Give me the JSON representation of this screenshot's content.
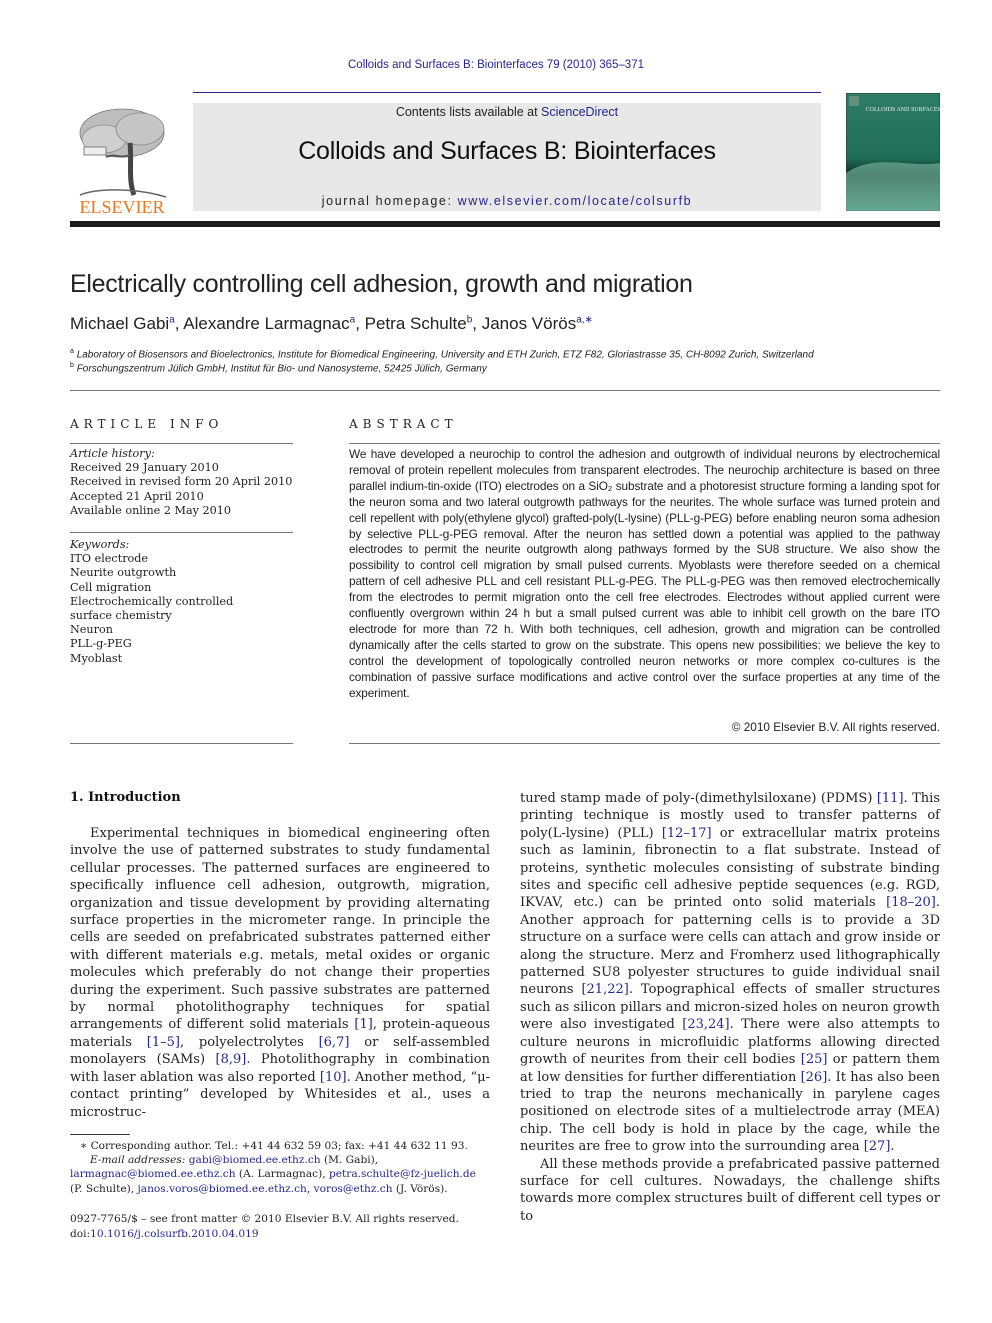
{
  "header": {
    "running_head": "Colloids and Surfaces B: Biointerfaces 79 (2010) 365–371",
    "contents_prefix": "Contents lists available at ",
    "contents_link": "ScienceDirect",
    "journal_title": "Colloids and Surfaces B: Biointerfaces",
    "homepage_prefix": "journal homepage: ",
    "homepage_link": "www.elsevier.com/locate/colsurfb",
    "publisher_logo_text": "ELSEVIER",
    "cover_title": "COLLOIDS AND SURFACES B",
    "colors": {
      "link": "#26268a",
      "elsevier_orange": "#e87722",
      "banner_bg": "#e8e8e8",
      "cover_green": "#1f6e55"
    }
  },
  "article": {
    "title": "Electrically controlling cell adhesion, growth and migration",
    "authors": [
      {
        "name": "Michael Gabi",
        "sup": "a"
      },
      {
        "name": "Alexandre Larmagnac",
        "sup": "a"
      },
      {
        "name": "Petra Schulte",
        "sup": "b"
      },
      {
        "name": "Janos Vörös",
        "sup": "a,∗"
      }
    ],
    "affiliations": [
      {
        "sup": "a",
        "text": "Laboratory of Biosensors and Bioelectronics, Institute for Biomedical Engineering, University and ETH Zurich, ETZ F82, Gloriastrasse 35, CH-8092 Zurich, Switzerland"
      },
      {
        "sup": "b",
        "text": "Forschungszentrum Jülich GmbH, Institut für Bio- und Nanosysteme, 52425 Jülich, Germany"
      }
    ]
  },
  "article_info": {
    "heading": "ARTICLE INFO",
    "history_label": "Article history:",
    "history": [
      "Received 29 January 2010",
      "Received in revised form 20 April 2010",
      "Accepted 21 April 2010",
      "Available online 2 May 2010"
    ],
    "keywords_label": "Keywords:",
    "keywords": [
      "ITO electrode",
      "Neurite outgrowth",
      "Cell migration",
      "Electrochemically controlled surface chemistry",
      "Neuron",
      "PLL-g-PEG",
      "Myoblast"
    ]
  },
  "abstract": {
    "heading": "ABSTRACT",
    "text": "We have developed a neurochip to control the adhesion and outgrowth of individual neurons by electrochemical removal of protein repellent molecules from transparent electrodes. The neurochip architecture is based on three parallel indium-tin-oxide (ITO) electrodes on a SiO₂ substrate and a photoresist structure forming a landing spot for the neuron soma and two lateral outgrowth pathways for the neurites. The whole surface was turned protein and cell repellent with poly(ethylene glycol) grafted-poly(L-lysine) (PLL-g-PEG) before enabling neuron soma adhesion by selective PLL-g-PEG removal. After the neuron has settled down a potential was applied to the pathway electrodes to permit the neurite outgrowth along pathways formed by the SU8 structure. We also show the possibility to control cell migration by small pulsed currents. Myoblasts were therefore seeded on a chemical pattern of cell adhesive PLL and cell resistant PLL-g-PEG. The PLL-g-PEG was then removed electrochemically from the electrodes to permit migration onto the cell free electrodes. Electrodes without applied current were confluently overgrown within 24 h but a small pulsed current was able to inhibit cell growth on the bare ITO electrode for more than 72 h. With both techniques, cell adhesion, growth and migration can be controlled dynamically after the cells started to grow on the substrate. This opens new possibilities: we believe the key to control the development of topologically controlled neuron networks or more complex co-cultures is the combination of passive surface modifications and active control over the surface properties at any time of the experiment.",
    "copyright": "© 2010 Elsevier B.V. All rights reserved."
  },
  "introduction": {
    "heading": "1.  Introduction",
    "left_col": [
      {
        "t": "Experimental techniques in biomedical engineering often involve the use of patterned substrates to study fundamental cellular processes. The patterned surfaces are engineered to specifically influence cell adhesion, outgrowth, migration, organization and tissue development by providing alternating surface properties in the micrometer range. In principle the cells are seeded on prefabricated substrates patterned either with different materials e.g. metals, metal oxides or organic molecules which preferably do not change their properties during the experiment. Such passive substrates are patterned by normal photolithography techniques for spatial arrangements of different solid materials "
      },
      {
        "ref": "[1]"
      },
      {
        "t": ", protein-aqueous materials "
      },
      {
        "ref": "[1–5]"
      },
      {
        "t": ", polyelectrolytes "
      },
      {
        "ref": "[6,7]"
      },
      {
        "t": " or self-assembled monolayers (SAMs) "
      },
      {
        "ref": "[8,9]"
      },
      {
        "t": ". Photolithography in combination with laser ablation was also reported "
      },
      {
        "ref": "[10]"
      },
      {
        "t": ". Another method, “μ-contact printing” developed by Whitesides et al., uses a microstruc-"
      }
    ],
    "right_col_p1": [
      {
        "t": "tured stamp made of poly-(dimethylsiloxane) (PDMS) "
      },
      {
        "ref": "[11]"
      },
      {
        "t": ". This printing technique is mostly used to transfer patterns of poly(L-lysine) (PLL) "
      },
      {
        "ref": "[12–17]"
      },
      {
        "t": " or extracellular matrix proteins such as laminin, fibronectin to a flat substrate. Instead of proteins, synthetic molecules consisting of substrate binding sites and specific cell adhesive peptide sequences (e.g. RGD, IKVAV, etc.) can be printed onto solid materials "
      },
      {
        "ref": "[18–20]"
      },
      {
        "t": ". Another approach for patterning cells is to provide a 3D structure on a surface were cells can attach and grow inside or along the structure. Merz and Fromherz used lithographically patterned SU8 polyester structures to guide individual snail neurons "
      },
      {
        "ref": "[21,22]"
      },
      {
        "t": ". Topographical effects of smaller structures such as silicon pillars and micron-sized holes on neuron growth were also investigated "
      },
      {
        "ref": "[23,24]"
      },
      {
        "t": ". There were also attempts to culture neurons in microfluidic platforms allowing directed growth of neurites from their cell bodies "
      },
      {
        "ref": "[25]"
      },
      {
        "t": " or pattern them at low densities for further differentiation "
      },
      {
        "ref": "[26]"
      },
      {
        "t": ". It has also been tried to trap the neurons mechanically in parylene cages positioned on electrode sites of a multielectrode array (MEA) chip. The cell body is hold in place by the cage, while the neurites are free to grow into the surrounding area "
      },
      {
        "ref": "[27]"
      },
      {
        "t": "."
      }
    ],
    "right_col_p2": "All these methods provide a prefabricated passive patterned surface for cell cultures. Nowadays, the challenge shifts towards more complex structures built of different cell types or to"
  },
  "footnotes": {
    "corresponding": "∗ Corresponding author. Tel.: +41 44 632 59 03; fax: +41 44 632 11 93.",
    "email_label": "E-mail addresses:",
    "emails": [
      {
        "addr": "gabi@biomed.ee.ethz.ch",
        "who": " (M. Gabi),",
        "br": true
      },
      {
        "addr": "larmagnac@biomed.ee.ethz.ch",
        "who": " (A. Larmagnac), "
      },
      {
        "addr": "petra.schulte@fz-juelich.de",
        "who": "",
        "br": true
      },
      {
        "addr": "",
        "who": "(P. Schulte), "
      },
      {
        "addr": "janos.voros@biomed.ee.ethz.ch",
        "who": ", "
      },
      {
        "addr": "voros@ethz.ch",
        "who": " (J. Vörös)."
      }
    ],
    "front_matter": "0927-7765/$ – see front matter © 2010 Elsevier B.V. All rights reserved.",
    "doi_prefix": "doi:",
    "doi": "10.1016/j.colsurfb.2010.04.019"
  }
}
